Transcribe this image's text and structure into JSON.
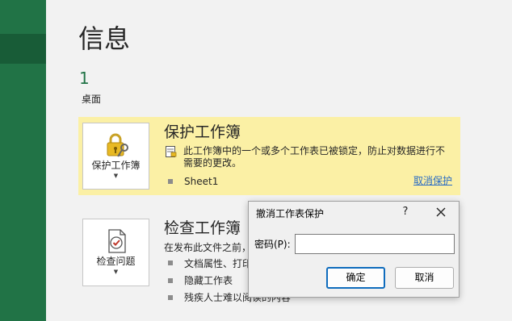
{
  "page": {
    "title": "信息"
  },
  "file": {
    "name": "1",
    "location": "桌面"
  },
  "protect": {
    "button_label": "保护工作簿",
    "title": "保护工作簿",
    "description": "此工作簿中的一个或多个工作表已被锁定，防止对数据进行不需要的更改。",
    "items": [
      "Sheet1"
    ],
    "unprotect_link": "取消保护"
  },
  "inspect": {
    "button_label": "检查问题",
    "title": "检查工作簿",
    "description": "在发布此文件之前，",
    "items": [
      "文档属性、打印",
      "隐藏工作表",
      "残疾人士难以阅读的内容"
    ]
  },
  "dialog": {
    "title": "撤消工作表保护",
    "help": "?",
    "password_label": "密码(P):",
    "password_value": "",
    "ok_label": "确定",
    "cancel_label": "取消"
  },
  "colors": {
    "sidebar": "#217346",
    "highlight": "#fbf0a5",
    "link": "#2b6cc4",
    "accent": "#0f6cbd"
  },
  "icons": {
    "protect": "lock-key-icon",
    "inspect": "document-check-icon",
    "description": "locked-sheet-icon",
    "close": "close-icon"
  }
}
